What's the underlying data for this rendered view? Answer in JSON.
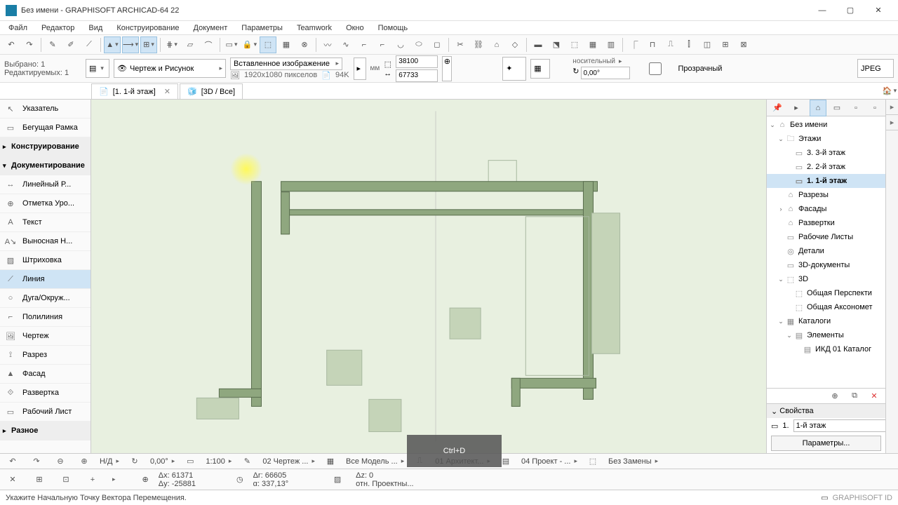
{
  "title": "Без имени - GRAPHISOFT ARCHICAD-64 22",
  "menu": [
    "Файл",
    "Редактор",
    "Вид",
    "Конструирование",
    "Документ",
    "Параметры",
    "Teamwork",
    "Окно",
    "Помощь"
  ],
  "selection": {
    "line1": "Выбрано: 1",
    "line2": "Редактируемых: 1"
  },
  "layer_dd": "Чертеж и Рисунок",
  "insert_dd": "Вставленное изображение",
  "img_res": "1920x1080 пикселов",
  "img_size": "94K",
  "unit": "мм",
  "coord_x": "38100",
  "coord_y": "67733",
  "bearing_label": "носительный",
  "angle": "0,00°",
  "transparent": "Прозрачный",
  "format": "JPEG",
  "tabs": [
    {
      "label": "[1. 1-й этаж]",
      "closable": true
    },
    {
      "label": "[3D / Все]",
      "closable": false
    }
  ],
  "toolbox": {
    "pointer": "Указатель",
    "marquee": "Бегущая Рамка",
    "construct": "Конструирование",
    "document": "Документирование",
    "items": [
      {
        "label": "Линейный Р...",
        "icon": "dim"
      },
      {
        "label": "Отметка Уро...",
        "icon": "level"
      },
      {
        "label": "Текст",
        "icon": "text"
      },
      {
        "label": "Выносная Н...",
        "icon": "label"
      },
      {
        "label": "Штриховка",
        "icon": "hatch"
      },
      {
        "label": "Линия",
        "icon": "line",
        "sel": true
      },
      {
        "label": "Дуга/Окруж...",
        "icon": "arc"
      },
      {
        "label": "Полилиния",
        "icon": "poly"
      },
      {
        "label": "Чертеж",
        "icon": "drawing"
      },
      {
        "label": "Разрез",
        "icon": "section"
      },
      {
        "label": "Фасад",
        "icon": "elev"
      },
      {
        "label": "Развертка",
        "icon": "ie"
      },
      {
        "label": "Рабочий Лист",
        "icon": "ws"
      }
    ],
    "misc": "Разное"
  },
  "navigator": {
    "root": "Без имени",
    "stories_grp": "Этажи",
    "stories": [
      "3. 3-й этаж",
      "2. 2-й этаж",
      "1. 1-й этаж"
    ],
    "sections": "Разрезы",
    "elevations": "Фасады",
    "ie": "Развертки",
    "worksheets": "Рабочие Листы",
    "details": "Детали",
    "docs3d": "3D-документы",
    "grp3d": "3D",
    "persp": "Общая Перспекти",
    "axo": "Общая Аксономет",
    "catalogs": "Каталоги",
    "elements": "Элементы",
    "cat_item": "ИКД 01 Каталог"
  },
  "props": {
    "header": "Свойства",
    "num": "1.",
    "name": "1-й этаж",
    "btn": "Параметры..."
  },
  "status_scale_label": "Н/Д",
  "status_angle": "0,00°",
  "status_scale": "1:100",
  "status_02": "02",
  "status_chert": "Чертеж ...",
  "status_all": "Все",
  "status_model": "Модель ...",
  "status_arch": "01 Архитект...",
  "status_proj": "04 Проект - ...",
  "status_noreplace": "Без Замены",
  "coords": {
    "dx": "Δx: 61371",
    "dy": "Δy: -25881",
    "dr": "Δr: 66605",
    "da": "α: 337,13°",
    "dz": "Δz: 0",
    "rel": "отн. Проектны..."
  },
  "prompt": "Укажите Начальную Точку Вектора Перемещения.",
  "brand": "GRAPHISOFT ID",
  "shortcut": "Ctrl+D"
}
